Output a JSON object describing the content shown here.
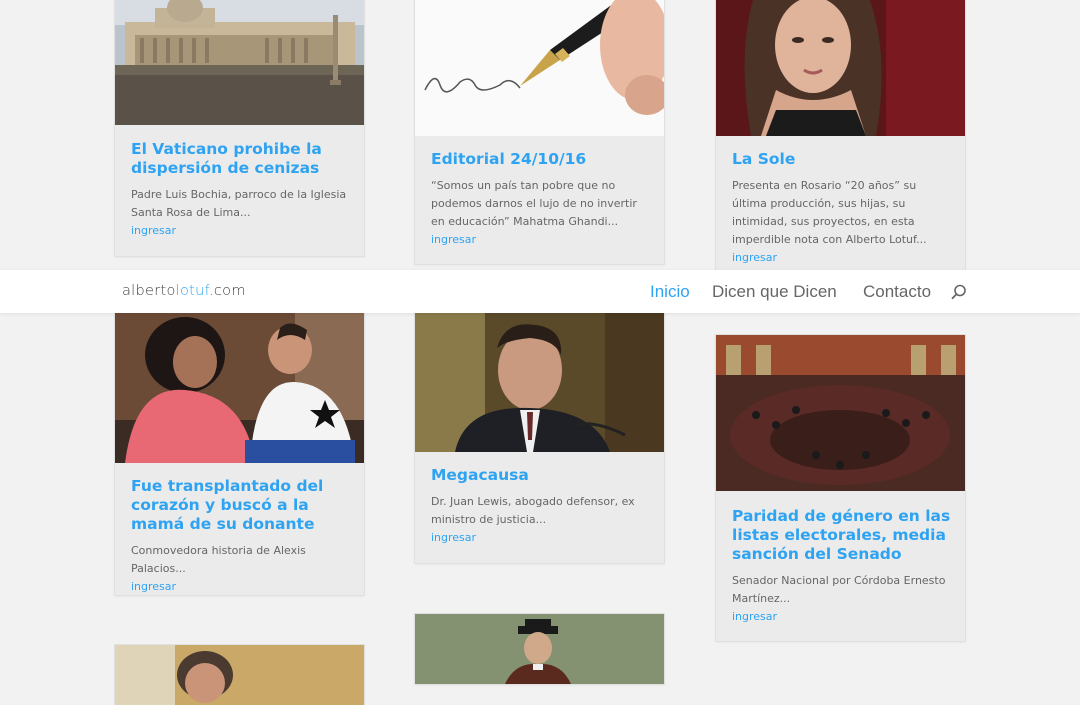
{
  "site": {
    "logo_part1": "alberto",
    "logo_part2": "lotuf",
    "logo_part3": ".com"
  },
  "nav": {
    "items": [
      {
        "label": "Inicio",
        "active": true
      },
      {
        "label": "Dicen que Dicen",
        "active": false
      },
      {
        "label": "Contacto",
        "active": false
      }
    ]
  },
  "posts": [
    {
      "title": "El Vaticano prohibe la dispersión de cenizas",
      "excerpt": "Padre Luis Bochia, parroco de la Iglesia Santa Rosa de Lima...",
      "more": "ingresar"
    },
    {
      "title": "Editorial 24/10/16",
      "excerpt": "“Somos un país tan pobre que no podemos darnos el lujo de no invertir en educación” Mahatma Ghandi...",
      "more": "ingresar"
    },
    {
      "title": "La Sole",
      "excerpt": "Presenta en Rosario “20 años” su última producción, sus hijas, su intimidad, sus proyectos, en esta imperdible nota con Alberto Lotuf...",
      "more": "ingresar"
    },
    {
      "title": "Fue transplantado del corazón y buscó a la mamá de su donante",
      "excerpt": "Conmovedora historia de Alexis Palacios...",
      "more": "ingresar"
    },
    {
      "title": "Megacausa",
      "excerpt": "Dr. Juan Lewis, abogado defensor, ex ministro de justicia...",
      "more": "ingresar"
    },
    {
      "title": "Paridad de género en las listas electorales, media sanción del Senado",
      "excerpt": "Senador Nacional por Córdoba Ernesto Martínez...",
      "more": "ingresar"
    }
  ]
}
